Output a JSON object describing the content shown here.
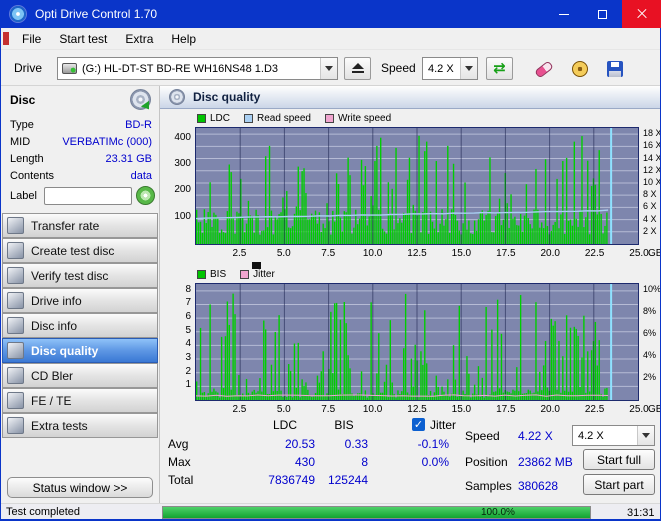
{
  "window": {
    "title": "Opti Drive Control 1.70"
  },
  "menu": {
    "items": [
      "File",
      "Start test",
      "Extra",
      "Help"
    ]
  },
  "toolbar": {
    "drive_label": "Drive",
    "drive_value": "(G:)  HL-DT-ST BD-RE  WH16NS48 1.D3",
    "speed_label": "Speed",
    "speed_value": "4.2 X"
  },
  "sidebar": {
    "group_title": "Disc",
    "info": [
      {
        "label": "Type",
        "value": "BD-R"
      },
      {
        "label": "MID",
        "value": "VERBATIMc (000)"
      },
      {
        "label": "Length",
        "value": "23.31 GB"
      },
      {
        "label": "Contents",
        "value": "data"
      }
    ],
    "label_caption": "Label",
    "label_value": "",
    "buttons": [
      {
        "label": "Transfer rate",
        "active": false
      },
      {
        "label": "Create test disc",
        "active": false
      },
      {
        "label": "Verify test disc",
        "active": false
      },
      {
        "label": "Drive info",
        "active": false
      },
      {
        "label": "Disc info",
        "active": false
      },
      {
        "label": "Disc quality",
        "active": true
      },
      {
        "label": "CD Bler",
        "active": false
      },
      {
        "label": "FE / TE",
        "active": false
      },
      {
        "label": "Extra tests",
        "active": false
      }
    ],
    "status_window_label": "Status window >>"
  },
  "main": {
    "header": "Disc quality"
  },
  "chart_data": [
    {
      "type": "bar",
      "name": "ldc-read-speed-chart",
      "legend": [
        {
          "label": "LDC",
          "color": "#00C400"
        },
        {
          "label": "Read speed",
          "color": "#A9CFF2"
        },
        {
          "label": "Write speed",
          "color": "#F0A5CF"
        }
      ],
      "y_left_ticks": [
        "400",
        "300",
        "200",
        "100"
      ],
      "y_left_max": 440,
      "y_right_ticks": [
        "18 X",
        "16 X",
        "14 X",
        "12 X",
        "10 X",
        "8 X",
        "6 X",
        "4 X",
        "2 X"
      ],
      "y_right_max": 19,
      "x_ticks": [
        "2.5",
        "5.0",
        "7.5",
        "10.0",
        "12.5",
        "15.0",
        "17.5",
        "20.0",
        "22.5",
        "25.0"
      ],
      "x_unit": "GB",
      "data_end_gb": 23.31,
      "summary": {
        "avg": 20.53,
        "max": 430,
        "total": 7836749
      },
      "read_speed_line": {
        "start_speed_x": 4.2,
        "end_speed_x": 5.5
      },
      "bars": {
        "seed": 12345,
        "count": 215,
        "base_min": 8,
        "base_max": 30,
        "spike_prob": 0.27,
        "spike_min": 32,
        "spike_max": 97
      }
    },
    {
      "type": "bar",
      "name": "bis-jitter-chart",
      "legend": [
        {
          "label": "BIS",
          "color": "#00C400"
        },
        {
          "label": "Jitter",
          "color": "#F0A5CF"
        }
      ],
      "y_left_ticks": [
        "8",
        "7",
        "6",
        "5",
        "4",
        "3",
        "2",
        "1"
      ],
      "y_left_max": 8.5,
      "y_right_ticks": [
        "10%",
        "8%",
        "6%",
        "4%",
        "2%"
      ],
      "y_right_max": 10.5,
      "x_ticks": [
        "2.5",
        "5.0",
        "7.5",
        "10.0",
        "12.5",
        "15.0",
        "17.5",
        "20.0",
        "22.5",
        "25.0"
      ],
      "x_unit": "GB",
      "data_end_gb": 23.31,
      "summary": {
        "avg": 0.33,
        "max": 8,
        "total": 125244
      },
      "bars": {
        "seed": 777,
        "count": 215,
        "base_min": 2,
        "base_max": 9,
        "spike_prob": 0.48,
        "spike_min": 9,
        "spike_max": 92
      }
    }
  ],
  "stats": {
    "columns": [
      "LDC",
      "BIS"
    ],
    "jitter_label": "Jitter",
    "jitter_checked": true,
    "rows": [
      {
        "label": "Avg",
        "ldc": "20.53",
        "bis": "0.33",
        "jitter": "-0.1%"
      },
      {
        "label": "Max",
        "ldc": "430",
        "bis": "8",
        "jitter": "0.0%"
      },
      {
        "label": "Total",
        "ldc": "7836749",
        "bis": "125244",
        "jitter": ""
      }
    ],
    "speed_label": "Speed",
    "speed_value": "4.22 X",
    "speed_combo": "4.2 X",
    "position_label": "Position",
    "position_value": "23862 MB",
    "samples_label": "Samples",
    "samples_value": "380628",
    "start_full_label": "Start full",
    "start_part_label": "Start part"
  },
  "statusbar": {
    "status": "Test completed",
    "progress": "100.0%",
    "time": "31:31"
  }
}
